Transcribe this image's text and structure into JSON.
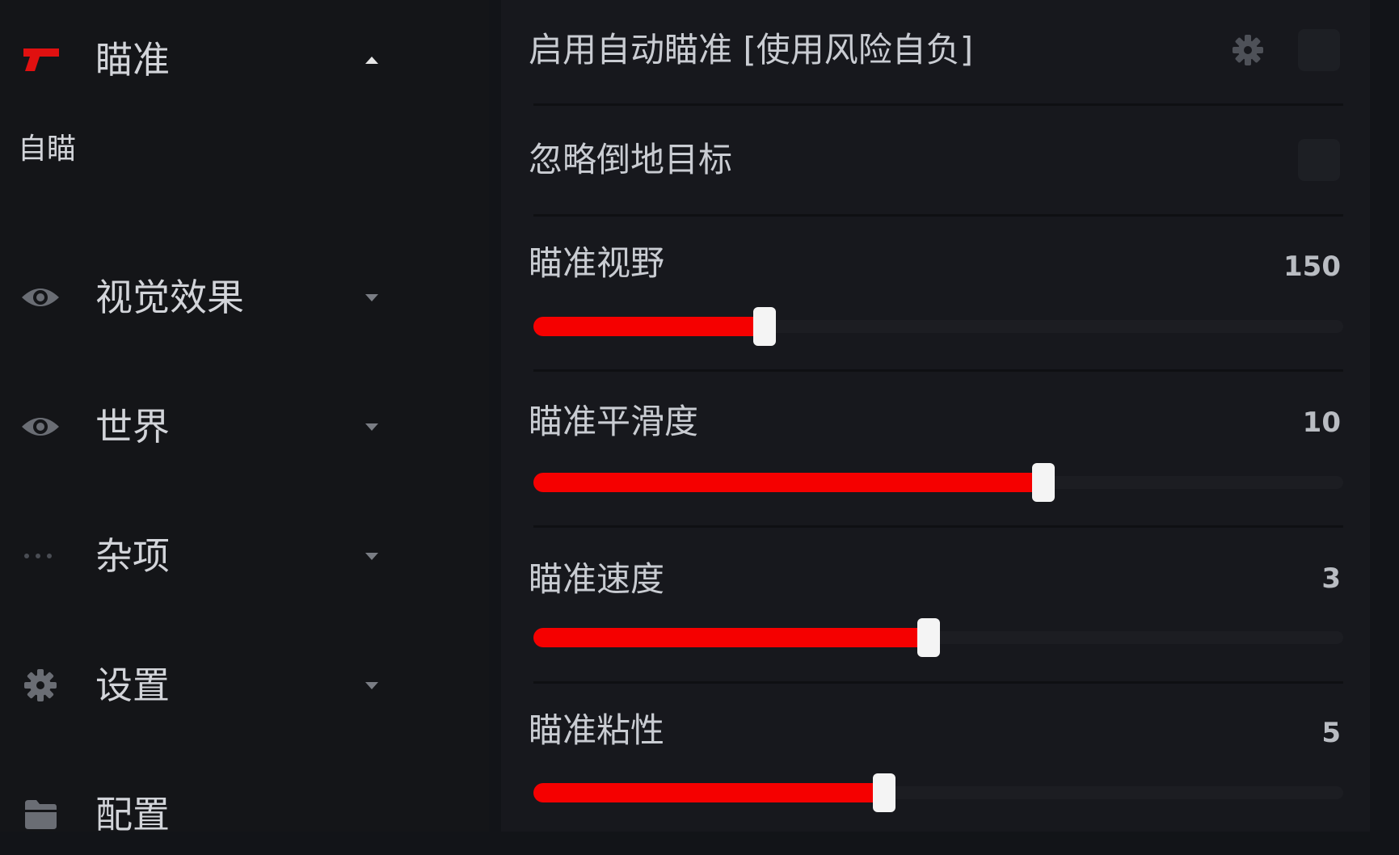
{
  "sidebar": {
    "items": [
      {
        "label": "瞄准",
        "icon": "gun-icon",
        "expanded": true
      },
      {
        "label": "视觉效果",
        "icon": "eye-icon",
        "expanded": false
      },
      {
        "label": "世界",
        "icon": "eye-icon",
        "expanded": false
      },
      {
        "label": "杂项",
        "icon": "dots-icon",
        "expanded": false
      },
      {
        "label": "设置",
        "icon": "gear-icon",
        "expanded": false
      },
      {
        "label": "配置",
        "icon": "folder-icon",
        "expanded": false
      }
    ],
    "subitems": [
      {
        "label": "自瞄"
      }
    ]
  },
  "main": {
    "toggles": [
      {
        "label": "启用自动瞄准 [使用风险自负]",
        "has_gear": true,
        "enabled": false
      },
      {
        "label": "忽略倒地目标",
        "has_gear": false,
        "enabled": false
      }
    ],
    "sliders": [
      {
        "label": "瞄准视野",
        "value": "150",
        "fill": 0.285
      },
      {
        "label": "瞄准平滑度",
        "value": "10",
        "fill": 0.63
      },
      {
        "label": "瞄准速度",
        "value": "3",
        "fill": 0.488
      },
      {
        "label": "瞄准粘性",
        "value": "5",
        "fill": 0.433
      }
    ]
  },
  "colors": {
    "accent": "#f50000",
    "background": "#121418",
    "panel": "#17181d",
    "text": "#c9ccd2"
  }
}
